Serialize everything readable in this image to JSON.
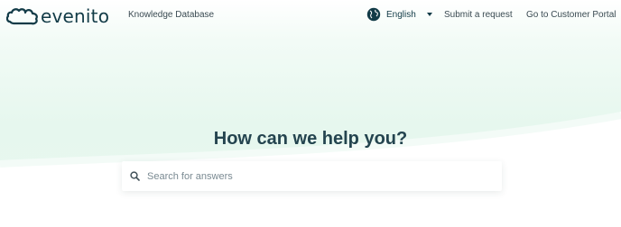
{
  "header": {
    "brand": "evenito",
    "nav_kb": "Knowledge Database",
    "language": {
      "label": "English",
      "icon": "globe-icon"
    },
    "nav_submit": "Submit a request",
    "nav_portal": "Go to Customer Portal"
  },
  "hero": {
    "title": "How can we help you?",
    "search": {
      "placeholder": "Search for answers",
      "value": "",
      "icon": "search-icon"
    }
  },
  "colors": {
    "brand_dark": "#123b47",
    "hero_green": "#e6f7ee",
    "title_text": "#24444f"
  }
}
